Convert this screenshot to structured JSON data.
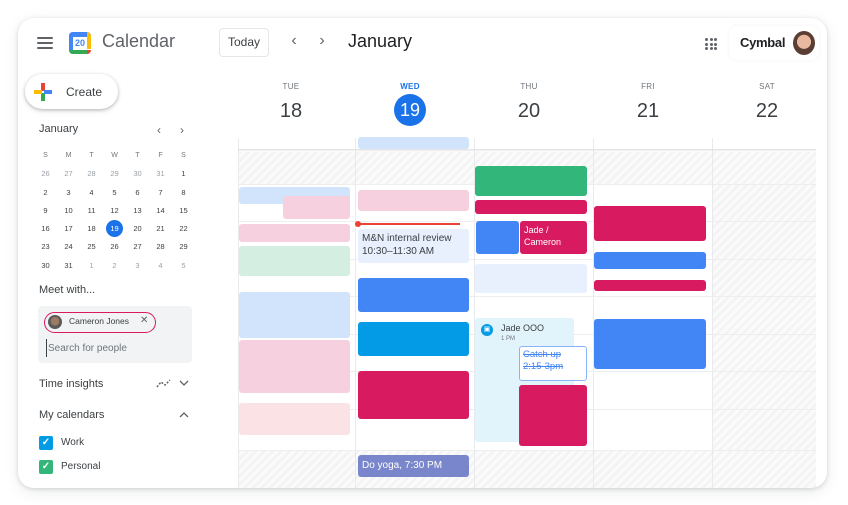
{
  "header": {
    "app_title": "Calendar",
    "logo_day": "20",
    "today_label": "Today",
    "prev_label": "‹",
    "next_label": "›",
    "month_title": "January",
    "brand": "Cymbal"
  },
  "sidebar": {
    "create_label": "Create",
    "mini_calendar": {
      "month": "January",
      "prev": "‹",
      "next": "›",
      "weekdays": [
        "S",
        "M",
        "T",
        "W",
        "T",
        "F",
        "S"
      ],
      "weeks": [
        [
          "26",
          "27",
          "28",
          "29",
          "30",
          "31",
          "1"
        ],
        [
          "2",
          "3",
          "4",
          "5",
          "6",
          "7",
          "8"
        ],
        [
          "9",
          "10",
          "11",
          "12",
          "13",
          "14",
          "15"
        ],
        [
          "16",
          "17",
          "18",
          "19",
          "20",
          "21",
          "22"
        ],
        [
          "23",
          "24",
          "25",
          "26",
          "27",
          "28",
          "29"
        ],
        [
          "30",
          "31",
          "1",
          "2",
          "3",
          "4",
          "5"
        ]
      ],
      "today": "19"
    },
    "meet_with": {
      "title": "Meet with...",
      "chip_name": "Cameron Jones",
      "chip_remove": "✕",
      "search_placeholder": "Search for people"
    },
    "time_insights": "Time insights",
    "my_calendars": {
      "title": "My calendars",
      "items": [
        {
          "label": "Work",
          "color": "#039be5",
          "checked": true
        },
        {
          "label": "Personal",
          "color": "#33b679",
          "checked": true
        }
      ]
    }
  },
  "week": {
    "days": [
      {
        "dow": "TUE",
        "date": "18",
        "today": false
      },
      {
        "dow": "WED",
        "date": "19",
        "today": true
      },
      {
        "dow": "THU",
        "date": "20",
        "today": false
      },
      {
        "dow": "FRI",
        "date": "21",
        "today": false
      },
      {
        "dow": "SAT",
        "date": "22",
        "today": false
      }
    ],
    "events": {
      "mn_review_title": "M&N internal review",
      "mn_review_time": "10:30–11:30 AM",
      "jade_cameron": "Jade / Cameron",
      "jade_ooo_title": "Jade OOO",
      "jade_ooo_time": "1 PM",
      "catch_up": "Catch up 2:15-3pm",
      "yoga": "Do yoga, 7:30 PM"
    }
  },
  "colors": {
    "accent": "#1a73e8",
    "tomato": "#d81b60",
    "blue": "#4285f4",
    "green": "#33b679",
    "peacock": "#039be5",
    "lavender": "#7986cb"
  }
}
